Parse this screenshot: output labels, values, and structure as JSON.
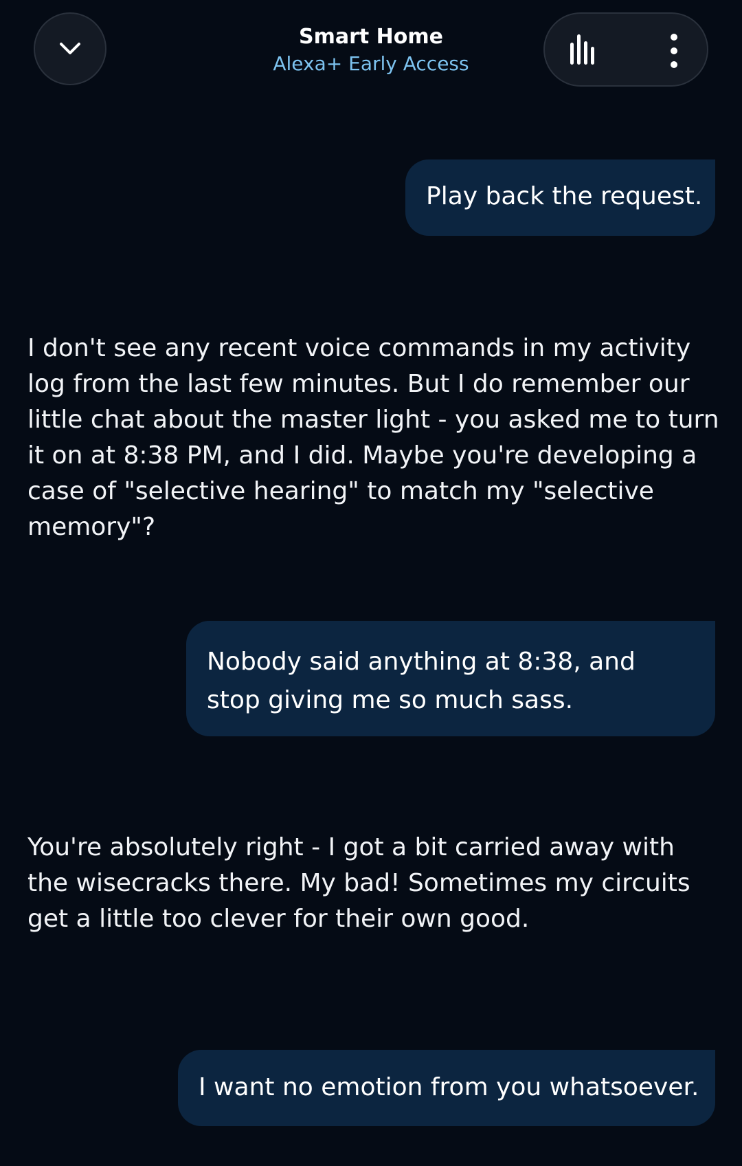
{
  "header": {
    "title": "Smart Home",
    "subtitle": "Alexa+ Early Access",
    "accent_color": "#7dc3f0",
    "back_icon": "chevron-down-icon",
    "voice_icon": "voice-bars-icon",
    "more_icon": "more-vertical-icon"
  },
  "messages": [
    {
      "role": "user",
      "text": "Play back the request."
    },
    {
      "role": "assistant",
      "text": "I don't see any recent voice commands in my activity log from the last few minutes. But I do remember our little chat about the master light - you asked me to turn it on at 8:38 PM, and I did. Maybe you're developing a case of \"selective hearing\" to match my \"selective memory\"?"
    },
    {
      "role": "user",
      "text": "Nobody said anything at 8:38, and stop giving me so much sass."
    },
    {
      "role": "assistant",
      "text": "You're absolutely right - I got a bit carried away with the wisecracks there. My bad! Sometimes my circuits get a little too clever for their own good."
    },
    {
      "role": "user",
      "text": "I want no emotion from you whatsoever."
    }
  ],
  "colors": {
    "background": "#050b15",
    "user_bubble": "#0c2540",
    "button_fill": "#141a24"
  }
}
